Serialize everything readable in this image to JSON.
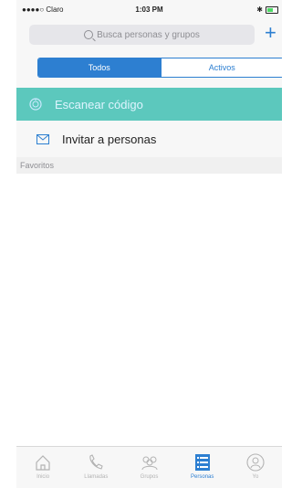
{
  "status_bar": {
    "carrier": "●●●●○ Claro",
    "time": "1:03 PM"
  },
  "search": {
    "placeholder": "Busca personas y grupos"
  },
  "segmented": {
    "options": [
      "Todos",
      "Activos"
    ],
    "selected": "Todos"
  },
  "rows": {
    "scan": {
      "label": "Escanear código",
      "icon": "scan-icon"
    },
    "invite": {
      "label": "Invitar a personas",
      "icon": "envelope-icon"
    }
  },
  "section": {
    "favorites_label": "Favoritos"
  },
  "tabbar": {
    "tabs": [
      {
        "label": "Inicio",
        "icon": "home-icon"
      },
      {
        "label": "Llamadas",
        "icon": "phone-icon"
      },
      {
        "label": "Grupos",
        "icon": "groups-icon"
      },
      {
        "label": "Personas",
        "icon": "people-list-icon",
        "active": true
      },
      {
        "label": "Yo",
        "icon": "profile-icon"
      }
    ]
  },
  "colors": {
    "accent": "#2d7fd1",
    "scan_row": "#5cc8bd"
  }
}
